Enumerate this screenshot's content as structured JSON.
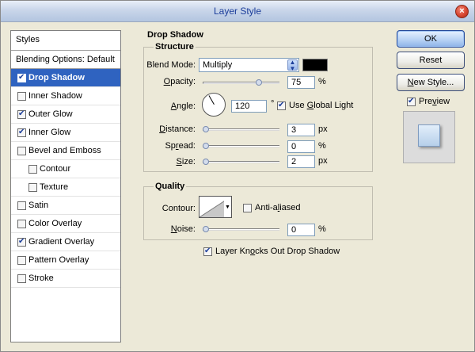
{
  "window": {
    "title": "Layer Style"
  },
  "styles": {
    "header": "Styles",
    "blending_options": "Blending Options: Default",
    "items": [
      {
        "label": "Drop Shadow",
        "checked": true,
        "selected": true,
        "indent": false
      },
      {
        "label": "Inner Shadow",
        "checked": false,
        "selected": false,
        "indent": false
      },
      {
        "label": "Outer Glow",
        "checked": true,
        "selected": false,
        "indent": false
      },
      {
        "label": "Inner Glow",
        "checked": true,
        "selected": false,
        "indent": false
      },
      {
        "label": "Bevel and Emboss",
        "checked": false,
        "selected": false,
        "indent": false
      },
      {
        "label": "Contour",
        "checked": false,
        "selected": false,
        "indent": true
      },
      {
        "label": "Texture",
        "checked": false,
        "selected": false,
        "indent": true
      },
      {
        "label": "Satin",
        "checked": false,
        "selected": false,
        "indent": false
      },
      {
        "label": "Color Overlay",
        "checked": false,
        "selected": false,
        "indent": false
      },
      {
        "label": "Gradient Overlay",
        "checked": true,
        "selected": false,
        "indent": false
      },
      {
        "label": "Pattern Overlay",
        "checked": false,
        "selected": false,
        "indent": false
      },
      {
        "label": "Stroke",
        "checked": false,
        "selected": false,
        "indent": false
      }
    ]
  },
  "drop_shadow": {
    "title": "Drop Shadow",
    "structure": {
      "title": "Structure",
      "blend_mode": {
        "label": "Blend Mode:",
        "value": "Multiply",
        "color": "#000000"
      },
      "opacity": {
        "label_pre": "",
        "label_ul": "O",
        "label_post": "pacity:",
        "value": "75",
        "unit": "%",
        "level": 0.75
      },
      "angle": {
        "label_pre": "",
        "label_ul": "A",
        "label_post": "ngle:",
        "value": "120",
        "unit": "°",
        "degrees": 120
      },
      "use_global_light": {
        "label_pre": "Use ",
        "label_ul": "G",
        "label_post": "lobal Light",
        "checked": true
      },
      "distance": {
        "label_pre": "",
        "label_ul": "D",
        "label_post": "istance:",
        "value": "3",
        "unit": "px",
        "level": 0.0
      },
      "spread": {
        "label_pre": "Sp",
        "label_ul": "r",
        "label_post": "ead:",
        "value": "0",
        "unit": "%",
        "level": 0.0
      },
      "size": {
        "label_pre": "",
        "label_ul": "S",
        "label_post": "ize:",
        "value": "2",
        "unit": "px",
        "level": 0.0
      }
    },
    "quality": {
      "title": "Quality",
      "contour": {
        "label": "Contour:"
      },
      "anti_aliased": {
        "label_pre": "Anti-a",
        "label_ul": "l",
        "label_post": "iased",
        "checked": false
      },
      "noise": {
        "label_pre": "",
        "label_ul": "N",
        "label_post": "oise:",
        "value": "0",
        "unit": "%",
        "level": 0.0
      }
    },
    "knockout": {
      "label_pre": "Layer Kn",
      "label_ul": "o",
      "label_post": "cks Out Drop Shadow",
      "checked": true
    }
  },
  "buttons": {
    "ok": "OK",
    "reset": "Reset",
    "new_style_pre": "",
    "new_style_ul": "N",
    "new_style_post": "ew Style...",
    "preview_pre": "Pre",
    "preview_ul": "v",
    "preview_post": "iew",
    "preview_checked": true
  }
}
